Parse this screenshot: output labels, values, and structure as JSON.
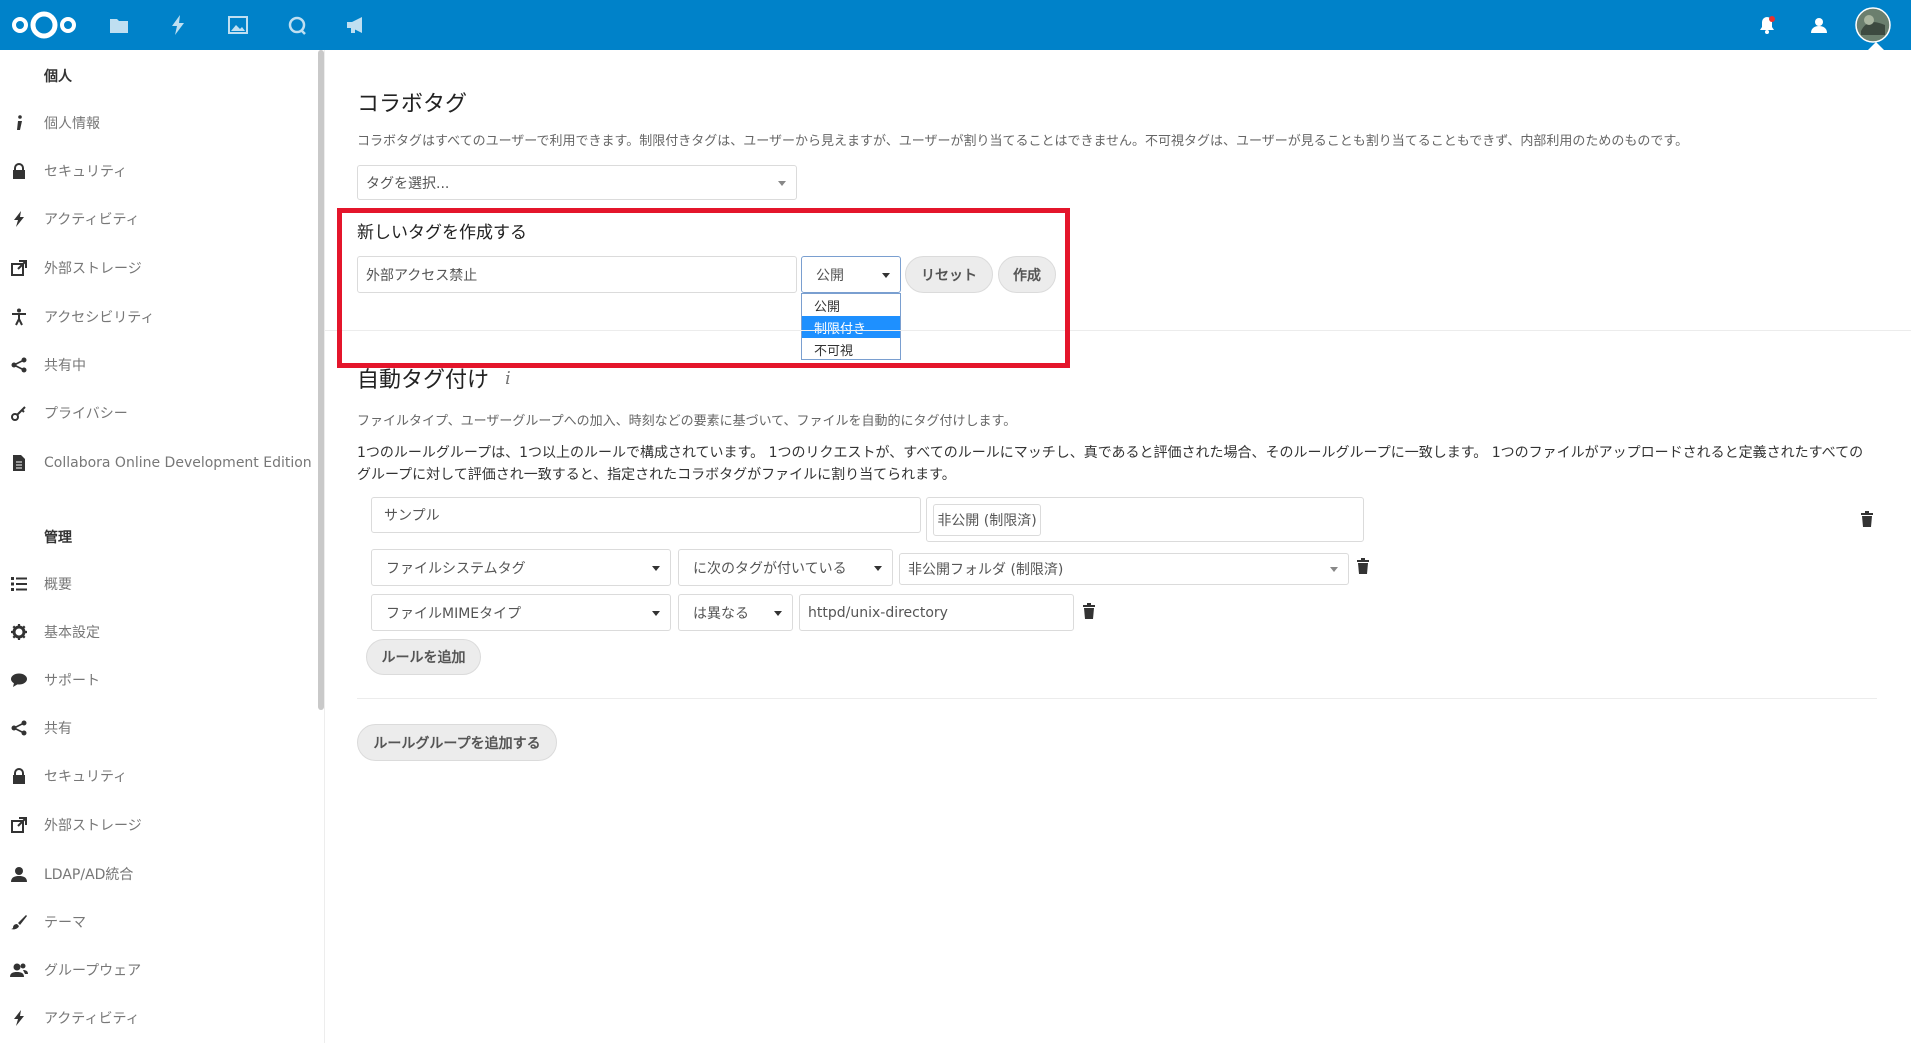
{
  "sidebar": {
    "personal_heading": "個人",
    "personal_items": [
      {
        "label": "個人情報",
        "icon": "info-icon"
      },
      {
        "label": "セキュリティ",
        "icon": "lock-icon"
      },
      {
        "label": "アクティビティ",
        "icon": "lightning-icon"
      },
      {
        "label": "外部ストレージ",
        "icon": "external-link-icon"
      },
      {
        "label": "アクセシビリティ",
        "icon": "accessibility-icon"
      },
      {
        "label": "共有中",
        "icon": "share-icon"
      },
      {
        "label": "プライバシー",
        "icon": "key-icon"
      },
      {
        "label": "Collabora Online Development Edition",
        "icon": "document-icon"
      }
    ],
    "admin_heading": "管理",
    "admin_items": [
      {
        "label": "概要",
        "icon": "list-icon"
      },
      {
        "label": "基本設定",
        "icon": "gear-icon"
      },
      {
        "label": "サポート",
        "icon": "chat-bubble-icon"
      },
      {
        "label": "共有",
        "icon": "share-icon"
      },
      {
        "label": "セキュリティ",
        "icon": "lock-icon"
      },
      {
        "label": "外部ストレージ",
        "icon": "external-link-icon"
      },
      {
        "label": "LDAP/AD統合",
        "icon": "user-icon"
      },
      {
        "label": "テーマ",
        "icon": "paint-brush-icon"
      },
      {
        "label": "グループウェア",
        "icon": "group-icon"
      },
      {
        "label": "アクティビティ",
        "icon": "lightning-icon"
      }
    ]
  },
  "collab_tags": {
    "title": "コラボタグ",
    "description": "コラボタグはすべてのユーザーで利用できます。制限付きタグは、ユーザーから見えますが、ユーザーが割り当てることはできません。不可視タグは、ユーザーが見ることも割り当てることもできず、内部利用のためのものです。",
    "select_placeholder": "タグを選択...",
    "new_tag_heading": "新しいタグを作成する",
    "new_tag_value": "外部アクセス禁止",
    "visibility_selected": "公開",
    "visibility_options": [
      "公開",
      "制限付き",
      "不可視"
    ],
    "visibility_highlighted": "制限付き",
    "reset_label": "リセット",
    "create_label": "作成"
  },
  "auto_tagging": {
    "title": "自動タグ付け",
    "info_icon": "i",
    "description": "ファイルタイプ、ユーザーグループへの加入、時刻などの要素に基づいて、ファイルを自動的にタグ付けします。",
    "explanation": "1つのルールグループは、1つ以上のルールで構成されています。 1つのリクエストが、すべてのルールにマッチし、真であると評価された場合、そのルールグループに一致します。 1つのファイルがアップロードされると定義されたすべてのグループに対して評価され一致すると、指定されたコラボタグがファイルに割り当てられます。",
    "rule_group": {
      "name": "サンプル",
      "assigned_tag": "非公開 (制限済)",
      "rules": [
        {
          "check": "ファイルシステムタグ",
          "operator": "に次のタグが付いている",
          "value": "非公開フォルダ (制限済)"
        },
        {
          "check": "ファイルMIMEタイプ",
          "operator": "は異なる",
          "value": "httpd/unix-directory"
        }
      ],
      "add_rule_label": "ルールを追加"
    },
    "add_group_label": "ルールグループを追加する"
  },
  "colors": {
    "header": "#0082c9",
    "highlight": "#e4152b",
    "selected_option": "#1e90ff"
  }
}
